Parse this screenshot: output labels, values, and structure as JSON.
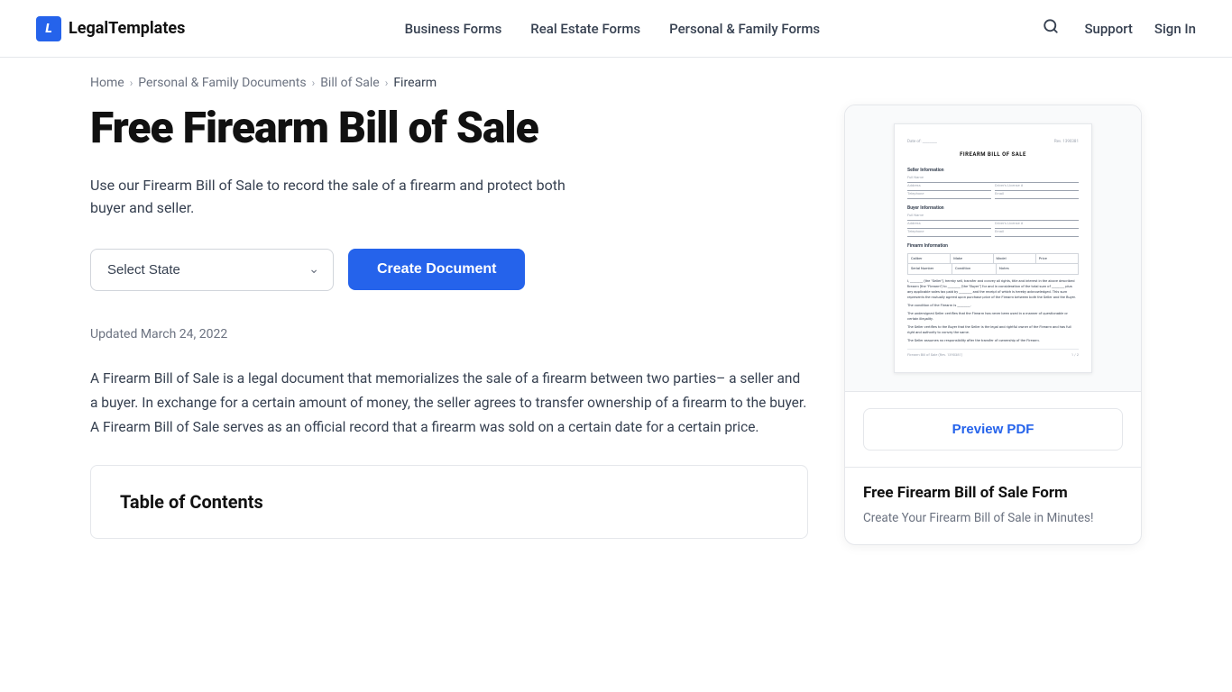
{
  "site": {
    "logo_letter": "L",
    "logo_name": "LegalTemplates"
  },
  "nav": {
    "items": [
      {
        "label": "Business Forms",
        "id": "business-forms"
      },
      {
        "label": "Real Estate Forms",
        "id": "real-estate-forms"
      },
      {
        "label": "Personal & Family Forms",
        "id": "personal-family-forms"
      }
    ],
    "support": "Support",
    "signin": "Sign In"
  },
  "breadcrumb": {
    "items": [
      {
        "label": "Home",
        "href": "#"
      },
      {
        "label": "Personal & Family Documents",
        "href": "#"
      },
      {
        "label": "Bill of Sale",
        "href": "#"
      },
      {
        "label": "Firearm",
        "href": "#",
        "current": true
      }
    ]
  },
  "hero": {
    "title": "Free Firearm Bill of Sale",
    "subtitle": "Use our Firearm Bill of Sale to record the sale of a firearm and protect both buyer and seller.",
    "select_placeholder": "Select State",
    "create_btn": "Create Document",
    "updated": "Updated March 24, 2022"
  },
  "body": {
    "paragraph": "A Firearm Bill of Sale is a legal document that memorializes the sale of a firearm between two parties– a seller and a buyer. In exchange for a certain amount of money, the seller agrees to transfer ownership of a firearm to the buyer. A Firearm Bill of Sale serves as an official record that a firearm was sold on a certain date for a certain price."
  },
  "toc": {
    "title": "Table of Contents"
  },
  "preview_card": {
    "doc_title": "FIREARM BILL OF SALE",
    "doc_rev": "Rev. 1390381",
    "date_label": "Date of: ________",
    "seller_section": "Seller Information",
    "buyer_section": "Buyer Information",
    "firearm_section": "Firearm Information",
    "footer_label": "Firearm Bill of Sale (Rev. 1390381)",
    "footer_page": "1 / 2",
    "preview_btn": "Preview PDF",
    "card_title": "Free Firearm Bill of Sale Form",
    "card_desc": "Create Your Firearm Bill of Sale in Minutes!"
  },
  "doc_fields": {
    "full_name": "Full Name",
    "address": "Address",
    "drivers_license": "Driver's License #",
    "telephone": "Telephone",
    "email": "Email",
    "table_headers": [
      "Caliber",
      "Make",
      "Model",
      "Price"
    ],
    "table_row2": [
      "Serial Number",
      "Condition",
      "Notes"
    ]
  },
  "colors": {
    "brand_blue": "#2563eb",
    "text_dark": "#111",
    "text_gray": "#374151",
    "border": "#e5e7eb"
  }
}
